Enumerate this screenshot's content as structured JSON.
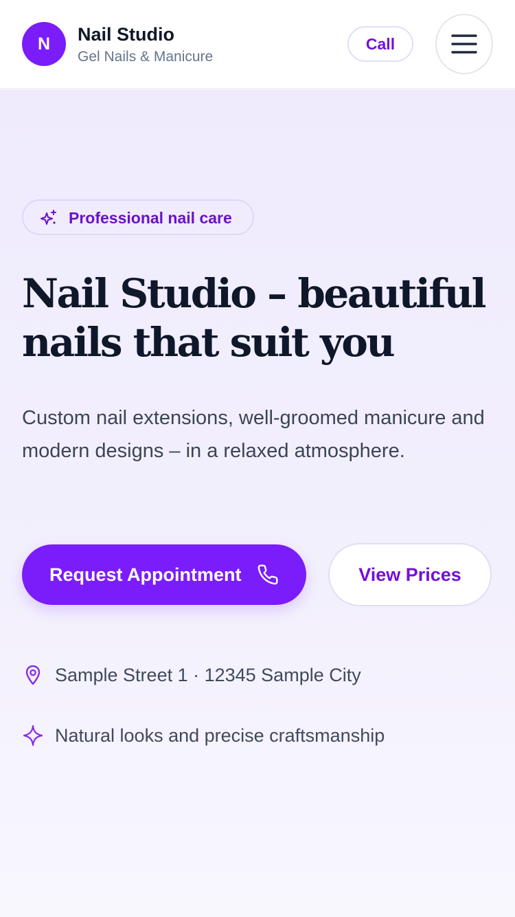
{
  "header": {
    "logo_letter": "N",
    "brand_name": "Nail Studio",
    "tagline": "Gel Nails & Manicure",
    "call_label": "Call",
    "menu_icon": "hamburger-menu-icon"
  },
  "hero": {
    "badge": {
      "icon": "sparkles-icon",
      "text": "Professional nail care"
    },
    "headline_line1": "Nail Studio – beautiful",
    "headline_line2": "nails that suit you",
    "subtitle": "Custom nail extensions, well-groomed manicure and modern designs – in a relaxed atmosphere.",
    "primary_button": {
      "label": "Request Appointment",
      "icon": "phone-icon"
    },
    "secondary_button": {
      "label": "View Prices"
    },
    "info": [
      {
        "icon": "location-pin-icon",
        "text": "Sample Street 1 · 12345 Sample City"
      },
      {
        "icon": "sparkle-icon",
        "text": "Natural looks and precise craftsmanship"
      }
    ]
  },
  "colors": {
    "accent": "#7b1cfa",
    "accent_text": "#7310d8",
    "heading": "#0f172a",
    "body_text": "#3a4556",
    "muted": "#64748b",
    "hero_background": "#efebfd"
  }
}
